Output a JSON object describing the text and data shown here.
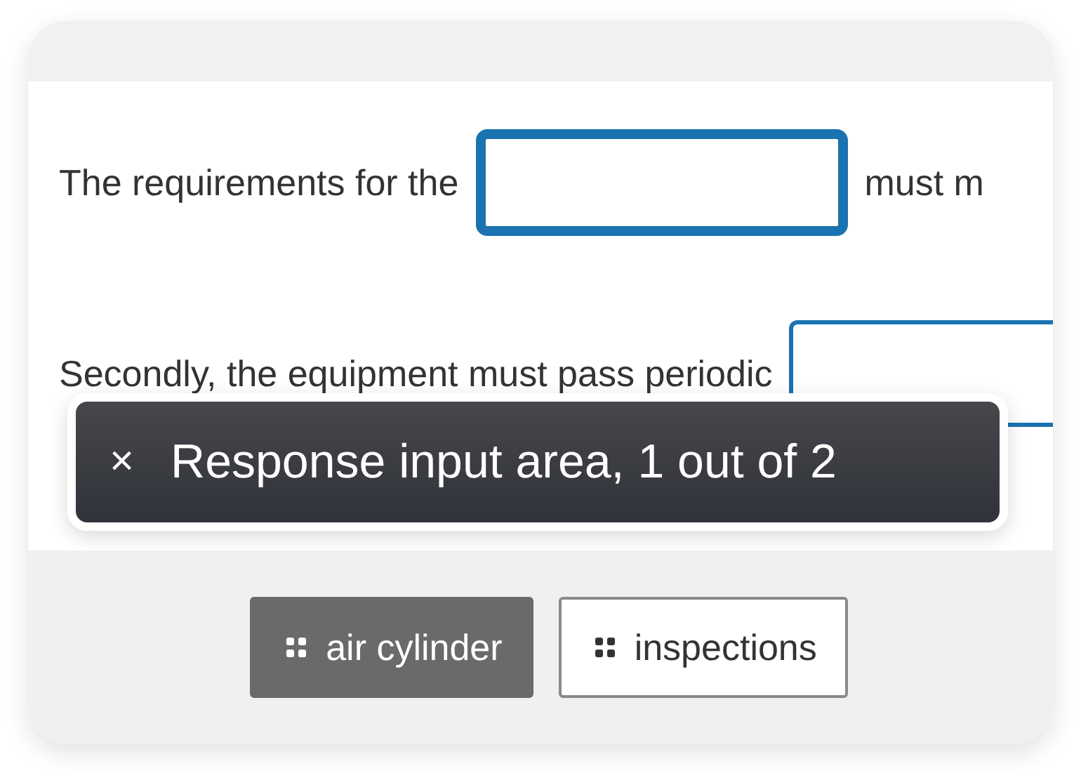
{
  "sentences": [
    {
      "parts": [
        {
          "kind": "text",
          "text": "The requirements for the"
        },
        {
          "kind": "blank",
          "focused": true
        },
        {
          "kind": "text",
          "text": "must m"
        }
      ]
    },
    {
      "parts": [
        {
          "kind": "text",
          "text": "Secondly, the equipment must pass periodic"
        },
        {
          "kind": "blank",
          "focused": false
        }
      ]
    }
  ],
  "tooltip": {
    "close": "×",
    "message": "Response input area, 1 out of 2"
  },
  "choices": [
    {
      "label": "air cylinder",
      "used": true
    },
    {
      "label": "inspections",
      "used": false
    }
  ]
}
